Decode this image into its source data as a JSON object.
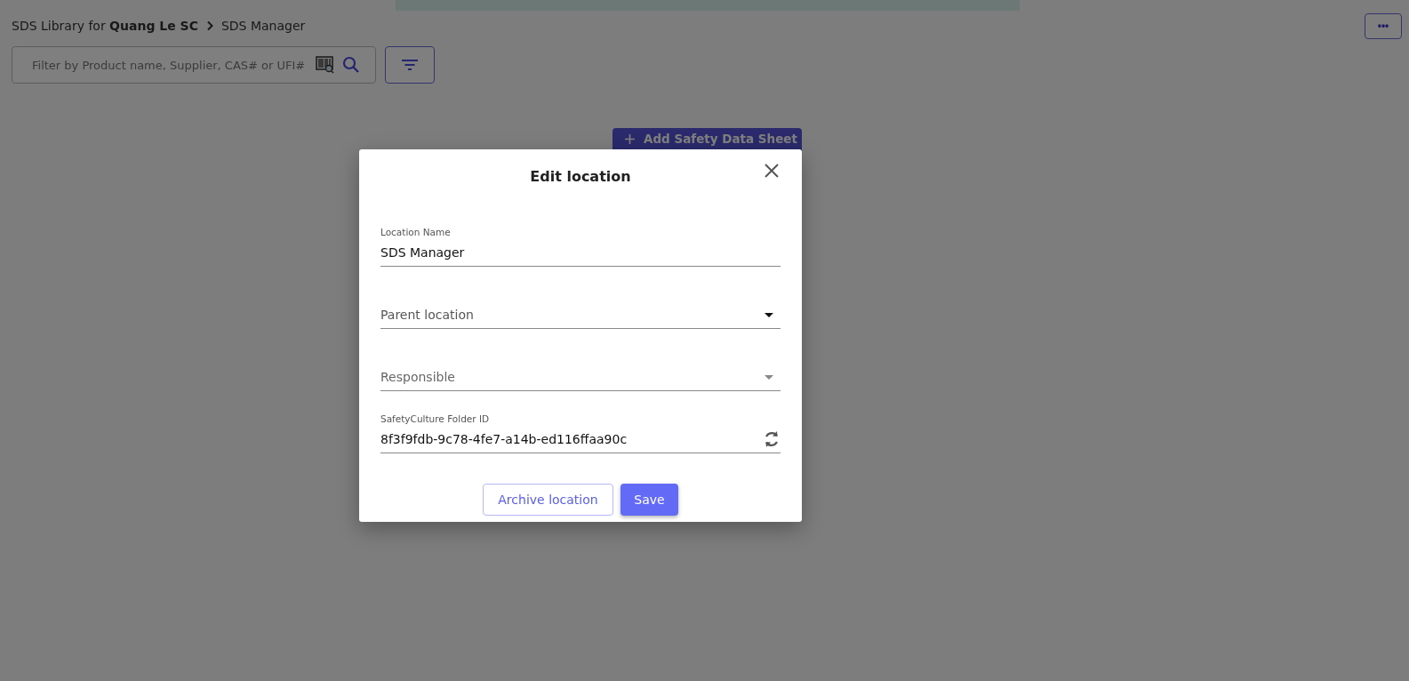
{
  "breadcrumb": {
    "prefix": "SDS Library for",
    "owner": "Quang Le SC",
    "current": "SDS Manager"
  },
  "more_button": {
    "label": "•••"
  },
  "search": {
    "placeholder": "Filter by Product name, Supplier, CAS# or UFI#"
  },
  "add_button": {
    "label": "Add Safety Data Sheet"
  },
  "dialog": {
    "title": "Edit location",
    "fields": [
      {
        "kind": "text",
        "label": "Location Name",
        "value": "SDS Manager"
      },
      {
        "kind": "select",
        "placeholder": "Parent location",
        "disabled": false
      },
      {
        "kind": "select",
        "placeholder": "Responsible",
        "disabled": true
      },
      {
        "kind": "text-action",
        "label": "SafetyCulture Folder ID",
        "value": "8f3f9fdb-9c78-4fe7-a14b-ed116ffaa90c"
      }
    ],
    "buttons": [
      {
        "kind": "outline",
        "label": "Archive location"
      },
      {
        "kind": "primary",
        "label": "Save"
      }
    ]
  }
}
